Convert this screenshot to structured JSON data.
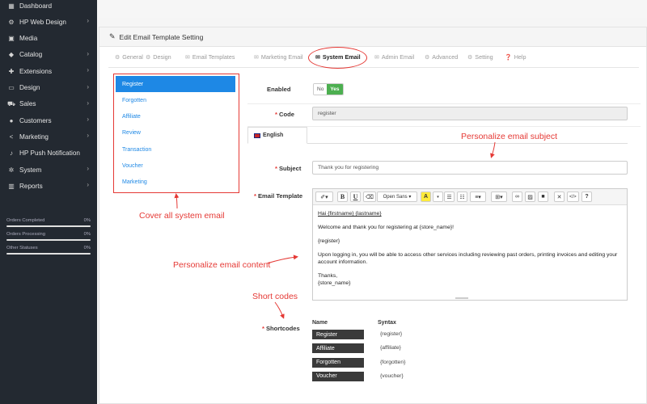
{
  "sidebar": {
    "items": [
      {
        "label": "Dashboard",
        "icon": "dashboard-icon",
        "glyph": "▦",
        "chev": false
      },
      {
        "label": "HP Web Design",
        "icon": "cogs-icon",
        "glyph": "⚙",
        "chev": true
      },
      {
        "label": "Media",
        "icon": "image-icon",
        "glyph": "▣",
        "chev": false
      },
      {
        "label": "Catalog",
        "icon": "tag-icon",
        "glyph": "◆",
        "chev": true
      },
      {
        "label": "Extensions",
        "icon": "puzzle-icon",
        "glyph": "✚",
        "chev": true
      },
      {
        "label": "Design",
        "icon": "monitor-icon",
        "glyph": "▭",
        "chev": true
      },
      {
        "label": "Sales",
        "icon": "cart-icon",
        "glyph": "⛟",
        "chev": true
      },
      {
        "label": "Customers",
        "icon": "user-icon",
        "glyph": "●",
        "chev": true
      },
      {
        "label": "Marketing",
        "icon": "share-icon",
        "glyph": "<",
        "chev": true
      },
      {
        "label": "HP Push Notification",
        "icon": "bell-icon",
        "glyph": "♪",
        "chev": false
      },
      {
        "label": "System",
        "icon": "gear-icon",
        "glyph": "✲",
        "chev": true
      },
      {
        "label": "Reports",
        "icon": "bar-chart-icon",
        "glyph": "▥",
        "chev": true
      }
    ],
    "stats": [
      {
        "label": "Orders Completed",
        "pct": "0%"
      },
      {
        "label": "Orders Processing",
        "pct": "0%"
      },
      {
        "label": "Other Statuses",
        "pct": "0%"
      }
    ]
  },
  "panel": {
    "title": "Edit Email Template Setting"
  },
  "tabs": [
    {
      "label": "General",
      "icon": "cogs-icon",
      "glyph": "⚙",
      "active": false
    },
    {
      "label": "Design",
      "icon": "cogs-icon",
      "glyph": "⚙",
      "active": false
    },
    {
      "label": "Email Templates",
      "icon": "envelope-icon",
      "glyph": "✉",
      "active": false
    },
    {
      "label": "Marketing Email",
      "icon": "envelope-icon",
      "glyph": "✉",
      "active": false
    },
    {
      "label": "System Email",
      "icon": "envelope-icon",
      "glyph": "✉",
      "active": true
    },
    {
      "label": "Admin Email",
      "icon": "envelope-icon",
      "glyph": "✉",
      "active": false
    },
    {
      "label": "Advanced",
      "icon": "cogs-icon",
      "glyph": "⚙",
      "active": false
    },
    {
      "label": "Setting",
      "icon": "cogs-icon",
      "glyph": "⚙",
      "active": false
    },
    {
      "label": "Help",
      "icon": "question-icon",
      "glyph": "❓",
      "active": false
    }
  ],
  "email_list": [
    "Register",
    "Forgotten",
    "Affiliate",
    "Review",
    "Transaction",
    "Voucher",
    "Marketing"
  ],
  "form": {
    "enabled_label": "Enabled",
    "toggle_no": "No",
    "toggle_yes": "Yes",
    "code_label": "Code",
    "code_value": "register",
    "lang_tab": "English",
    "subject_label": "Subject",
    "subject_value": "Thank you for registering",
    "template_label": "Email Template",
    "shortcodes_label": "Shortcodes"
  },
  "editor": {
    "font_select": "Open Sans",
    "lines": {
      "greeting": "Hai {firstname} {lastname}",
      "welcome": "Welcome and thank you for registering at {store_name}!",
      "register": "{register}",
      "login": "Upon logging in, you will be able to access other services including reviewing past orders, printing invoices and editing your account information.",
      "thanks": "Thanks,",
      "store": "{store_name}"
    }
  },
  "shortcodes": {
    "name_header": "Name",
    "syntax_header": "Syntax",
    "rows": [
      {
        "name": "Register",
        "syntax": "{register}"
      },
      {
        "name": "Affiliate",
        "syntax": "{affiliate}"
      },
      {
        "name": "Forgotten",
        "syntax": "{forgotten}"
      },
      {
        "name": "Voucher",
        "syntax": "{voucher}"
      }
    ]
  },
  "annotations": {
    "subject": "Personalize email subject",
    "system": "Cover all system email",
    "content": "Personalize email content",
    "shortcodes": "Short codes"
  },
  "colors": {
    "accent": "#1e88e5",
    "annotation": "#e53935",
    "enabled": "#4caf50",
    "sidebar": "#232931"
  }
}
